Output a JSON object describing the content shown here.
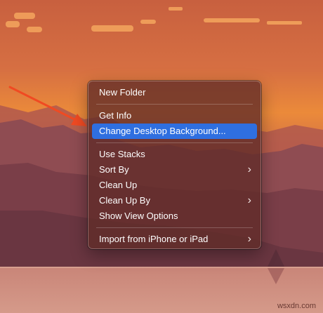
{
  "context_menu": {
    "items": [
      {
        "label": "New Folder",
        "submenu": false
      },
      {
        "label": "Get Info",
        "submenu": false
      },
      {
        "label": "Change Desktop Background...",
        "submenu": false,
        "highlighted": true
      },
      {
        "label": "Use Stacks",
        "submenu": false
      },
      {
        "label": "Sort By",
        "submenu": true
      },
      {
        "label": "Clean Up",
        "submenu": false
      },
      {
        "label": "Clean Up By",
        "submenu": true
      },
      {
        "label": "Show View Options",
        "submenu": false
      },
      {
        "label": "Import from iPhone or iPad",
        "submenu": true
      }
    ],
    "submenu_glyph": "›",
    "highlight_color": "#2f6fe0"
  },
  "annotation": {
    "icon": "red-arrow-icon",
    "color": "#f04a22"
  },
  "watermark": {
    "text": "wsxdn.com"
  },
  "colors": {
    "sky_top": "#cf6a45",
    "sky_glow": "#ec8a36",
    "mountains": "#8e4d52",
    "water": "#c98a80"
  }
}
